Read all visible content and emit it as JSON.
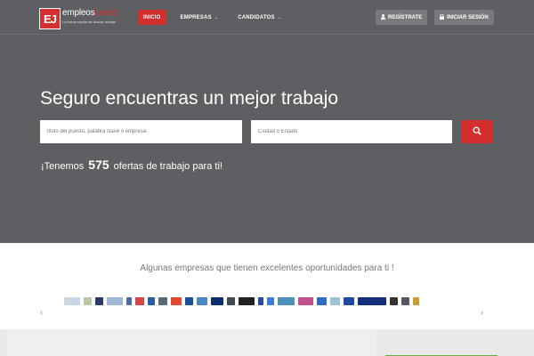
{
  "logo": {
    "mark": "EJ",
    "name_a": "empleos",
    "name_b": "juarez",
    "tagline": "La forma rápida de buscar trabajo"
  },
  "nav": {
    "items": [
      {
        "label": "INICIO",
        "active": true,
        "dropdown": false
      },
      {
        "label": "EMPRESAS",
        "active": false,
        "dropdown": true
      },
      {
        "label": "CANDIDATOS",
        "active": false,
        "dropdown": true
      }
    ],
    "register": "REGÍSTRATE",
    "login": "INICIAR SESIÓN"
  },
  "hero": {
    "headline": "Seguro encuentras un mejor trabajo",
    "search_placeholder": "titulo del puesto, palabra clave o empresa",
    "location_placeholder": "Ciudad o Estado",
    "offers_prefix": "¡Tenemos",
    "offers_count": "575",
    "offers_suffix": "ofertas de trabajo para ti!"
  },
  "companies": {
    "title": "Algunas empresas que tienen excelentes oportunidades para ti !",
    "logos": [
      "logo-1",
      "logo-2",
      "logo-3",
      "logo-4",
      "logo-5",
      "logo-6",
      "logo-7",
      "logo-8",
      "logo-9",
      "logo-10",
      "logo-11",
      "logo-12",
      "logo-13",
      "logo-14",
      "logo-15",
      "logo-16",
      "logo-17",
      "logo-18",
      "logo-19",
      "logo-20",
      "logo-21",
      "logo-22",
      "logo-23",
      "logo-24",
      "logo-25"
    ]
  },
  "colors": {
    "accent": "#d32f2f",
    "hero_bg": "#5d5f62",
    "green": "#6ab04c"
  }
}
